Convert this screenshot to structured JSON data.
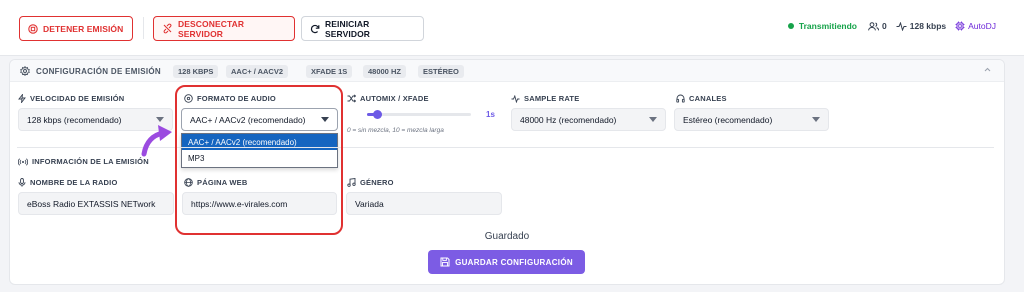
{
  "toolbar": {
    "stop_label": "DETENER EMISIÓN",
    "disconnect_label": "DESCONECTAR SERVIDOR",
    "restart_label": "REINICIAR SERVIDOR"
  },
  "status": {
    "state": "Transmitiendo",
    "listeners": "0",
    "bitrate": "128 kbps",
    "mode": "AutoDJ"
  },
  "colors": {
    "accent": "#7c5ce4",
    "danger": "#e03131",
    "live": "#16a34a",
    "selected": "#1565c0"
  },
  "config": {
    "title": "CONFIGURACIÓN DE EMISIÓN",
    "chips": [
      "128 KBPS",
      "AAC+ / AACV2",
      "XFADE 1S",
      "48000 HZ",
      "ESTÉREO"
    ]
  },
  "fields": {
    "speed": {
      "label": "VELOCIDAD DE EMISIÓN",
      "value": "128 kbps (recomendado)"
    },
    "format": {
      "label": "FORMATO DE AUDIO",
      "value": "AAC+ / AACv2 (recomendado)",
      "options": [
        "AAC+ / AACv2 (recomendado)",
        "MP3"
      ]
    },
    "automix": {
      "label": "AUTOMIX / XFADE",
      "value_label": "1s",
      "level": 0.1,
      "hint": "0 = sin mezcla, 10 = mezcla larga"
    },
    "sample_rate": {
      "label": "SAMPLE RATE",
      "value": "48000 Hz (recomendado)"
    },
    "channels": {
      "label": "CANALES",
      "value": "Estéreo (recomendado)"
    }
  },
  "info": {
    "title": "INFORMACIÓN DE LA EMISIÓN",
    "radio_name": {
      "label": "NOMBRE DE LA RADIO",
      "value": "eBoss Radio EXTASSIS NETwork"
    },
    "website": {
      "label": "PÁGINA WEB",
      "value": "https://www.e-virales.com"
    },
    "genre": {
      "label": "GÉNERO",
      "value": "Variada"
    }
  },
  "footer": {
    "saved_text": "Guardado",
    "save_label": "GUARDAR CONFIGURACIÓN"
  }
}
